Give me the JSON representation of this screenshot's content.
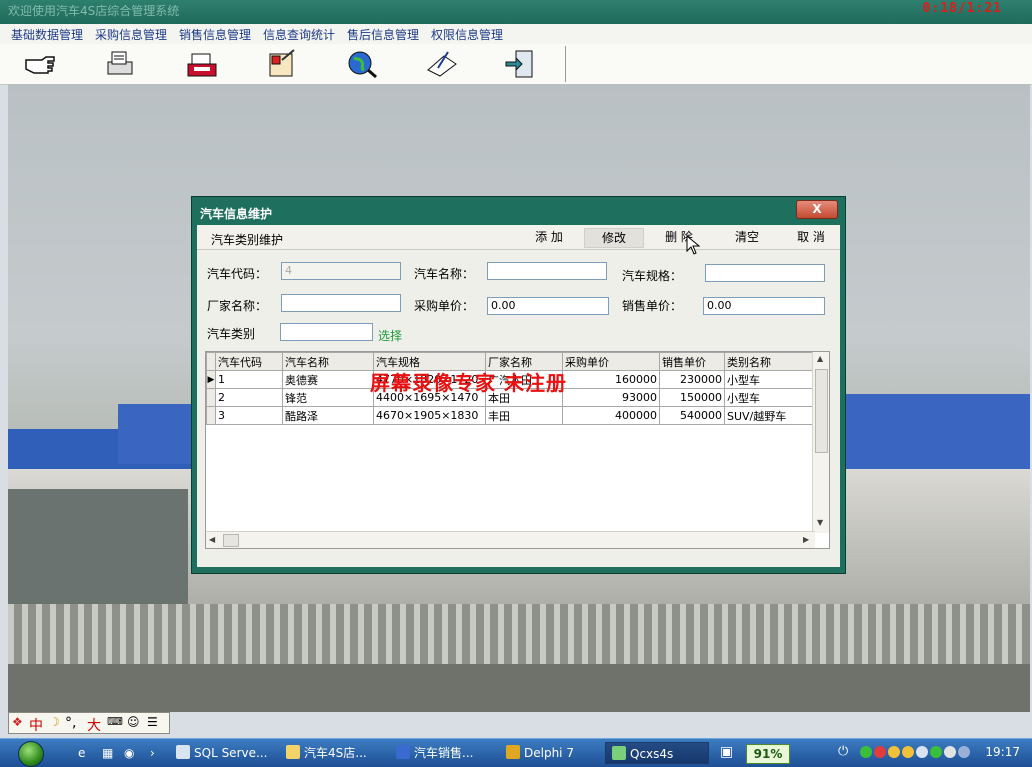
{
  "window": {
    "title": "欢迎使用汽车4S店综合管理系统",
    "timer": "0:18/1:21"
  },
  "menu": [
    "基础数据管理",
    "采购信息管理",
    "销售信息管理",
    "信息查询统计",
    "售后信息管理",
    "权限信息管理"
  ],
  "toolbar_icons": [
    "pointing-hand-icon",
    "printer-icon",
    "cash-register-icon",
    "notepad-icon",
    "globe-search-icon",
    "edit-notes-icon",
    "exit-door-icon"
  ],
  "dialog": {
    "title": "汽车信息维护",
    "close_label": "X",
    "tools_label": "汽车类别维护",
    "buttons": {
      "add": "添 加",
      "edit": "修改",
      "delete": "删 除",
      "clear": "清空",
      "cancel": "取 消"
    },
    "fields": {
      "code_label": "汽车代码：",
      "code_value": "4",
      "name_label": "汽车名称：",
      "name_value": "",
      "spec_label": "汽车规格：",
      "spec_value": "",
      "maker_label": "厂家名称：",
      "maker_value": "",
      "buy_label": "采购单价：",
      "buy_value": "0.00",
      "sell_label": "销售单价：",
      "sell_value": "0.00",
      "type_label": "汽车类别",
      "type_value": "",
      "select_link": "选择"
    },
    "grid": {
      "headers": [
        "汽车代码",
        "汽车名称",
        "汽车规格",
        "厂家名称",
        "采购单价",
        "销售单价",
        "类别名称"
      ],
      "rows": [
        [
          "1",
          "奥德赛",
          "4770×1820×1720",
          "广汽本田",
          "160000",
          "230000",
          "小型车"
        ],
        [
          "2",
          "锋范",
          "4400×1695×1470",
          "本田",
          "93000",
          "150000",
          "小型车"
        ],
        [
          "3",
          "酷路泽",
          "4670×1905×1830",
          "丰田",
          "400000",
          "540000",
          "SUV/越野车"
        ]
      ]
    },
    "watermark": "屏幕录像专家  未注册"
  },
  "ime": {
    "items": [
      "中",
      "°,",
      "大"
    ]
  },
  "taskbar": {
    "tasks": [
      "SQL Serve...",
      "汽车4S店...",
      "汽车销售...",
      "Delphi 7",
      "Qcxs4s"
    ],
    "percent": "91%",
    "clock": "19:17"
  }
}
